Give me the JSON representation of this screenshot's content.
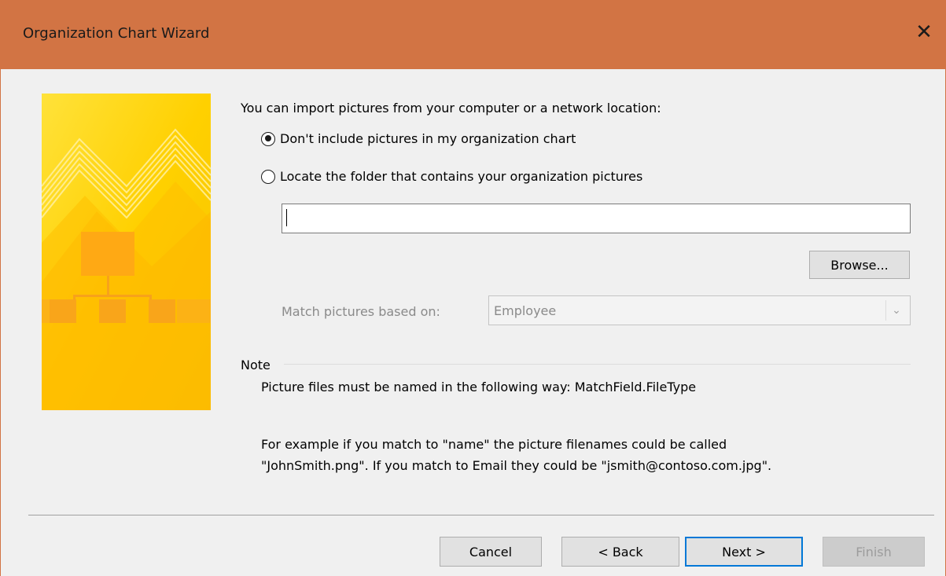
{
  "window": {
    "title": "Organization Chart Wizard",
    "close_glyph": "✕"
  },
  "colors": {
    "titlebar": "#d27444",
    "banner_gold": "#ffd200",
    "banner_orange": "#f7a21b",
    "default_button_border": "#0078d7"
  },
  "content": {
    "intro": "You can import pictures from your computer or a network location:",
    "options": [
      {
        "label": "Don't include pictures in my organization chart",
        "checked": true
      },
      {
        "label": "Locate the folder that contains your organization pictures",
        "checked": false
      }
    ],
    "folder_path": {
      "value": "",
      "placeholder": ""
    },
    "browse_label": "Browse...",
    "match_label": "Match pictures based on:",
    "match_selected": "Employee"
  },
  "note": {
    "label": "Note",
    "line1": "Picture files must be named in the following way: MatchField.FileType",
    "example_line1": "For example if you match to \"name\" the picture filenames could be called",
    "example_line2": "\"JohnSmith.png\". If you match to Email they could be \"jsmith@contoso.com.jpg\"."
  },
  "footer": {
    "cancel": "Cancel",
    "back": "< Back",
    "next": "Next >",
    "finish": "Finish"
  }
}
